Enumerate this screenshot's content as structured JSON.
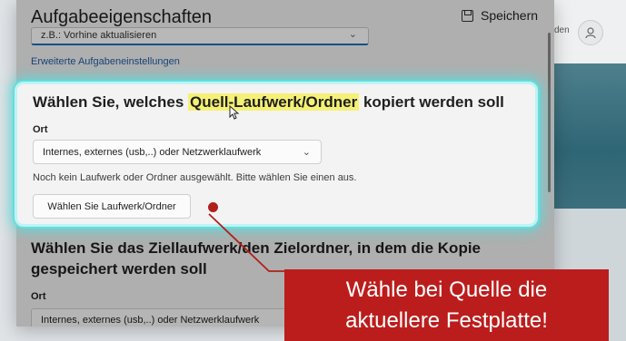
{
  "dialog": {
    "title": "Aufgabeeigenschaften",
    "save_label": "Speichern",
    "cut_select_value": "z.B.: Vorhine aktualisieren",
    "advanced_link": "Erweiterte Aufgabeneinstellungen"
  },
  "source_section": {
    "title_before": "Wählen Sie, welches ",
    "title_highlight": "Quell-Laufwerk/Ordner",
    "title_after": " kopiert werden soll",
    "location_label": "Ort",
    "location_value": "Internes, externes (usb,..) oder Netzwerklaufwerk",
    "hint": "Noch kein Laufwerk oder Ordner ausgewählt. Bitte wählen Sie einen aus.",
    "choose_button": "Wählen Sie Laufwerk/Ordner"
  },
  "target_section": {
    "title": "Wählen Sie das Ziellaufwerk/den Zielordner, in dem die Kopie gespeichert werden soll",
    "location_label": "Ort",
    "location_value": "Internes, externes (usb,..) oder Netzwerklaufwerk"
  },
  "background": {
    "topbar_text": "den"
  },
  "callout": {
    "line1": "Wähle bei Quelle die",
    "line2": "aktuellere Festplatte!"
  },
  "colors": {
    "highlight": "#f5f176",
    "glow": "#63dede",
    "callout": "#bb1d1c",
    "link": "#1e5fa6"
  }
}
